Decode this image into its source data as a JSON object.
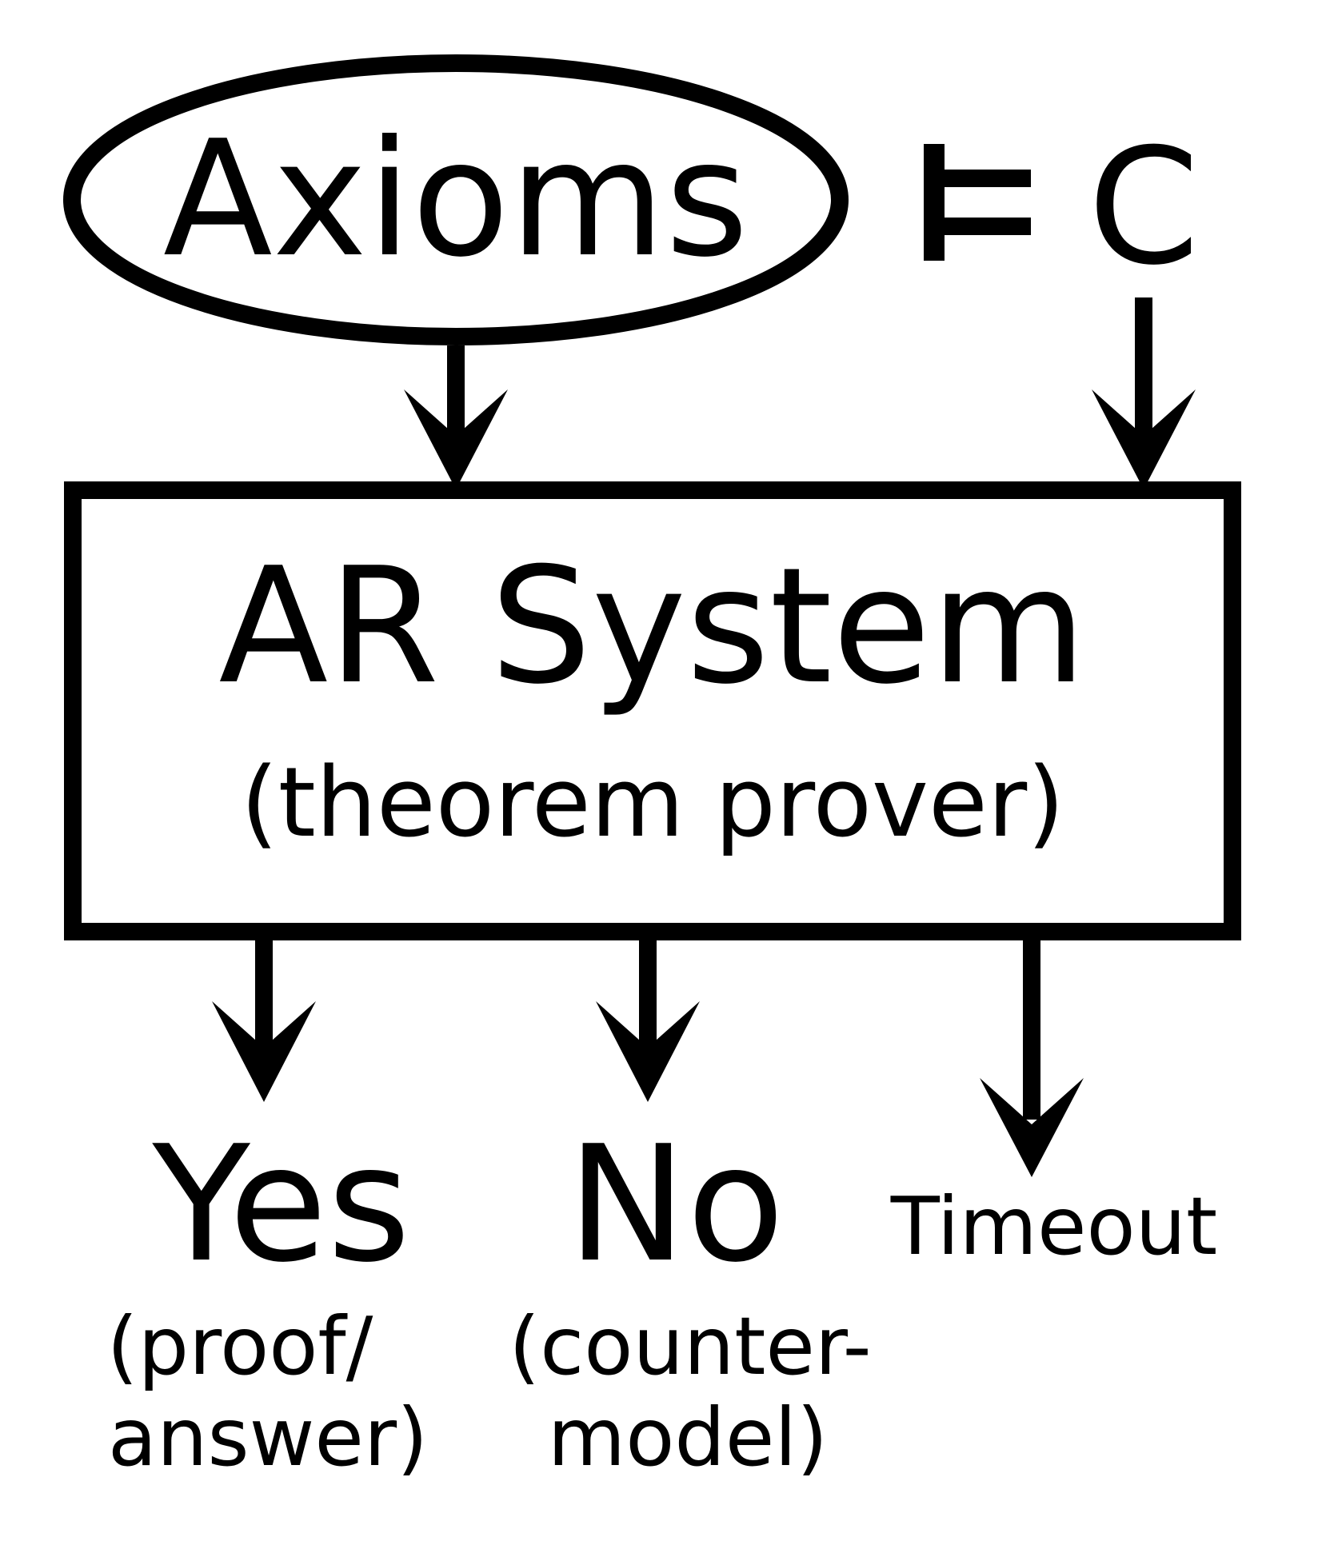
{
  "inputs": {
    "axioms": "Axioms",
    "entails_symbol": "⊨",
    "conjecture": "C"
  },
  "system": {
    "title": "AR System",
    "subtitle": "(theorem prover)"
  },
  "outputs": {
    "yes": {
      "label": "Yes",
      "detail_line1": "(proof/",
      "detail_line2": "answer)"
    },
    "no": {
      "label": "No",
      "detail_line1": "(counter-",
      "detail_line2": "model)"
    },
    "timeout": {
      "label": "Timeout"
    }
  },
  "colors": {
    "ink": "#000000",
    "background": "#ffffff"
  }
}
